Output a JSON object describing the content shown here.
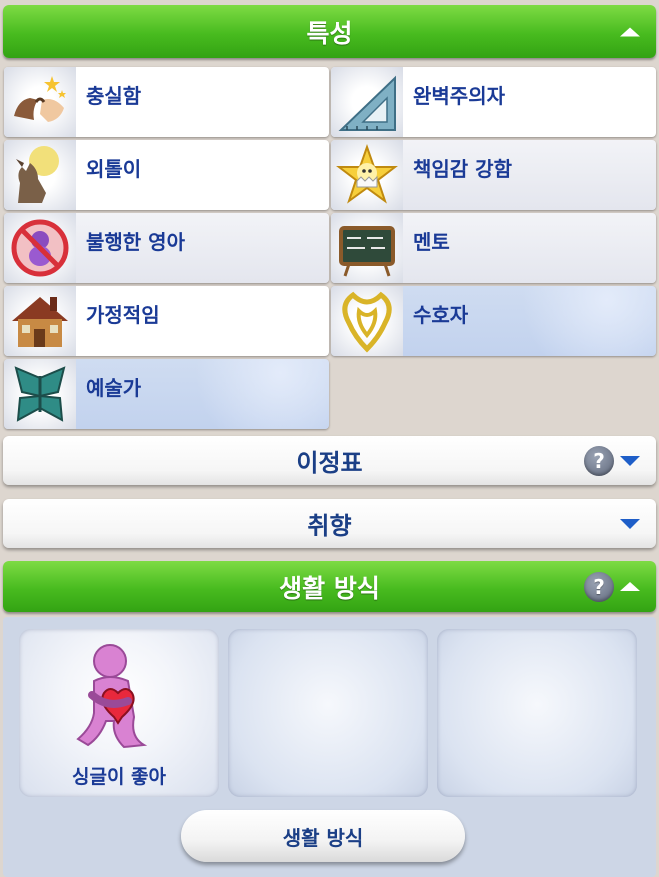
{
  "traits_section": {
    "title": "특성",
    "expanded": true
  },
  "traits": [
    {
      "label": "충실함",
      "icon": "pinky-promise-icon",
      "style": "white"
    },
    {
      "label": "완벽주의자",
      "icon": "set-square-ruler-icon",
      "style": "white"
    },
    {
      "label": "외톨이",
      "icon": "howling-wolf-icon",
      "style": "white"
    },
    {
      "label": "책임감 강함",
      "icon": "chick-star-icon",
      "style": "shade"
    },
    {
      "label": "불행한 영아",
      "icon": "no-baby-icon",
      "style": "shade"
    },
    {
      "label": "멘토",
      "icon": "chalkboard-icon",
      "style": "shade"
    },
    {
      "label": "가정적임",
      "icon": "house-icon",
      "style": "white"
    },
    {
      "label": "수호자",
      "icon": "gold-shield-emblem-icon",
      "style": "blue"
    },
    {
      "label": "예술가",
      "icon": "butterfly-icon",
      "style": "blue"
    }
  ],
  "milestones_section": {
    "title": "이정표",
    "expanded": false,
    "has_help": true
  },
  "preferences_section": {
    "title": "취향",
    "expanded": false
  },
  "lifestyle_section": {
    "title": "생활 방식",
    "expanded": true,
    "has_help": true
  },
  "lifestyle_slots": [
    {
      "label": "싱글이 좋아",
      "icon": "hugging-heart-figure-icon",
      "filled": true
    },
    {
      "label": "",
      "filled": false
    },
    {
      "label": "",
      "filled": false
    }
  ],
  "lifestyle_button": {
    "label": "생활 방식"
  },
  "help_glyph": "?",
  "colors": {
    "header_green": "#48bb1f",
    "text_blue": "#1a3a96",
    "arrow_blue": "#1e5ec8",
    "background": "#ddd6cf"
  }
}
